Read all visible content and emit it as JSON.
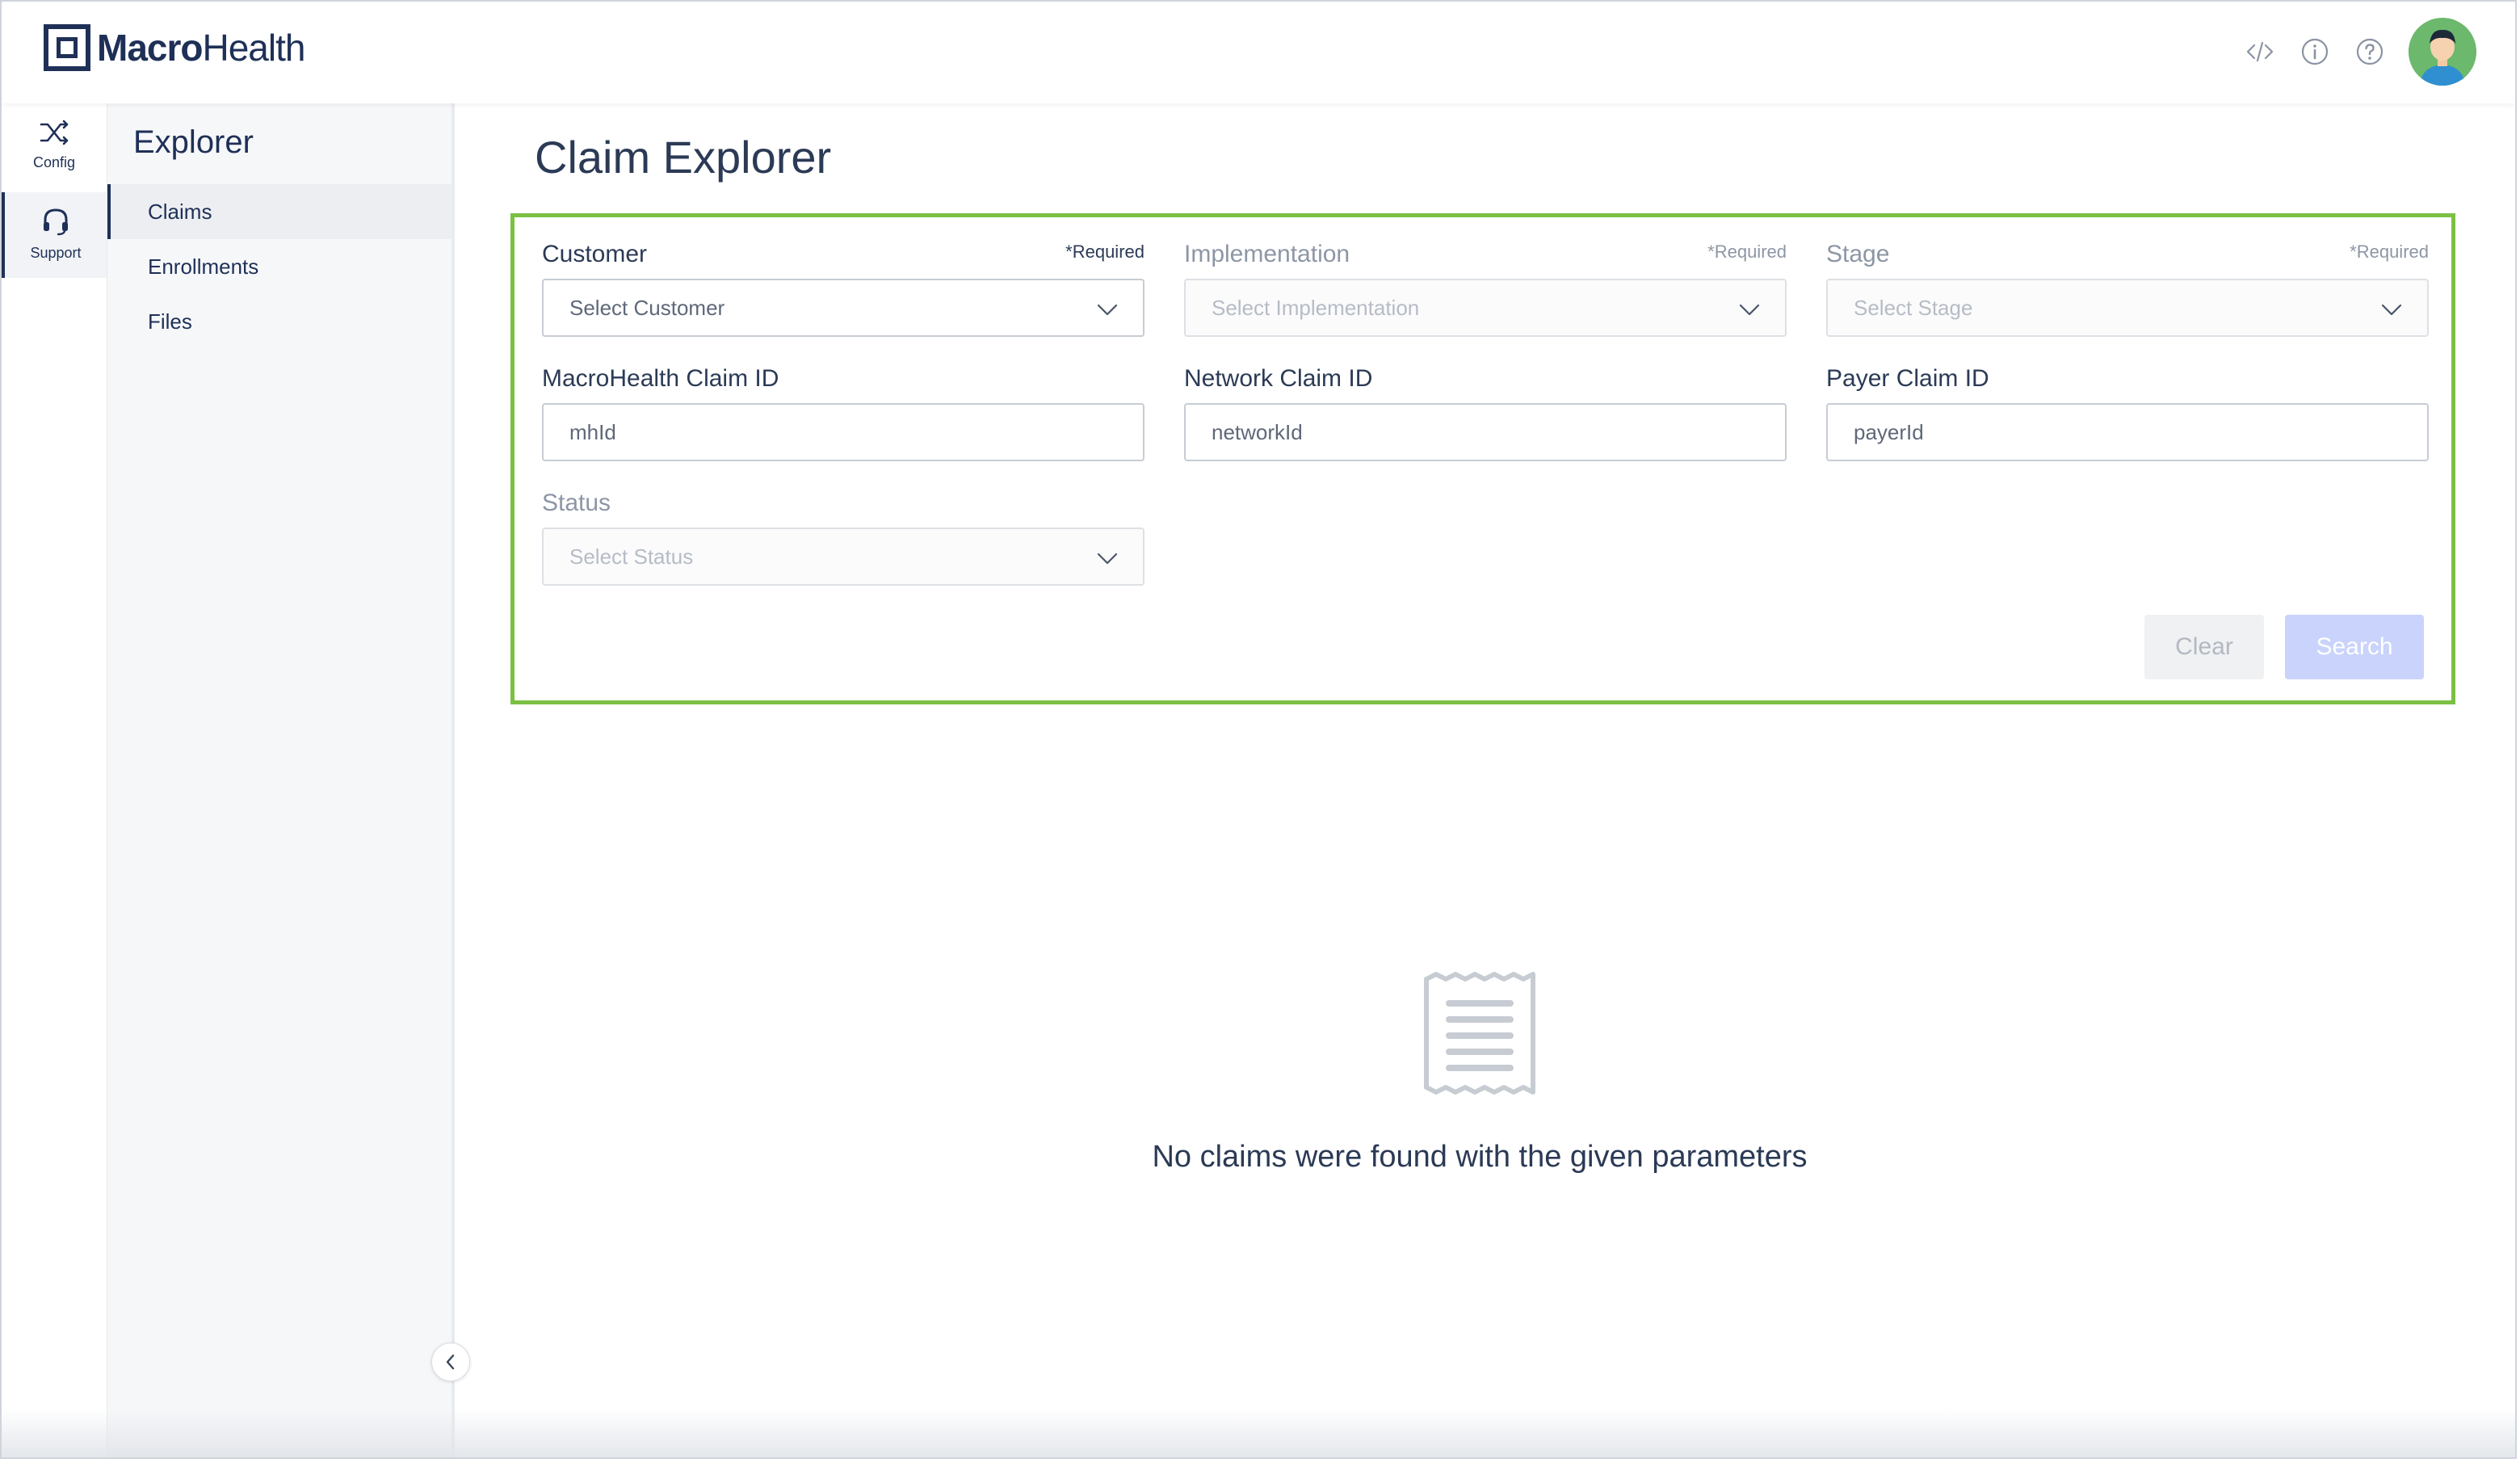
{
  "brand": {
    "name_bold": "Macro",
    "name_regular": "Health"
  },
  "top_icons": [
    "code-icon",
    "info-icon",
    "help-icon"
  ],
  "rail": [
    {
      "label": "Config",
      "icon": "shuffle-icon"
    },
    {
      "label": "Support",
      "icon": "headset-icon"
    }
  ],
  "subnav": {
    "title": "Explorer",
    "items": [
      {
        "label": "Claims"
      },
      {
        "label": "Enrollments"
      },
      {
        "label": "Files"
      }
    ]
  },
  "page": {
    "title": "Claim Explorer"
  },
  "form": {
    "customer": {
      "label": "Customer",
      "required": "*Required",
      "placeholder": "Select Customer"
    },
    "implementation": {
      "label": "Implementation",
      "required": "*Required",
      "placeholder": "Select Implementation"
    },
    "stage": {
      "label": "Stage",
      "required": "*Required",
      "placeholder": "Select Stage"
    },
    "mh_claim_id": {
      "label": "MacroHealth Claim ID",
      "placeholder": "mhId"
    },
    "network_claim_id": {
      "label": "Network Claim ID",
      "placeholder": "networkId"
    },
    "payer_claim_id": {
      "label": "Payer Claim ID",
      "placeholder": "payerId"
    },
    "status": {
      "label": "Status",
      "placeholder": "Select Status"
    },
    "clear_label": "Clear",
    "search_label": "Search"
  },
  "empty_state": {
    "message": "No claims were found with the given parameters"
  },
  "colors": {
    "brand": "#1f3057",
    "highlight_border": "#7bc043",
    "search_button": "#c9d3fb"
  }
}
